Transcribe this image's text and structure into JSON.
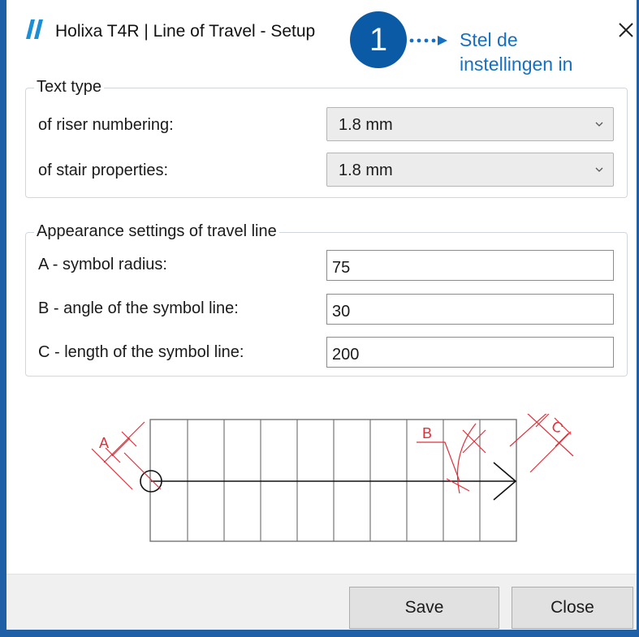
{
  "window": {
    "title": "Holixa T4R | Line of Travel - Setup"
  },
  "hint": {
    "step_number": "1",
    "line1": "Stel de",
    "line2": "instellingen in"
  },
  "text_type": {
    "legend": "Text type",
    "riser_label": "of riser numbering:",
    "riser_value": "1.8 mm",
    "properties_label": "of stair properties:",
    "properties_value": "1.8 mm"
  },
  "appearance": {
    "legend": "Appearance settings of travel line",
    "radius_label": "A - symbol radius:",
    "radius_value": "75",
    "angle_label": "B - angle of the symbol line:",
    "angle_value": "30",
    "length_label": "C - length of the symbol line:",
    "length_value": "200"
  },
  "diagram": {
    "label_a": "A",
    "label_b": "B",
    "label_c": "C"
  },
  "buttons": {
    "save": "Save",
    "close": "Close"
  },
  "colors": {
    "accent": "#0b5aa5",
    "hint_text": "#1570c4",
    "diagram_red": "#e0303a"
  }
}
